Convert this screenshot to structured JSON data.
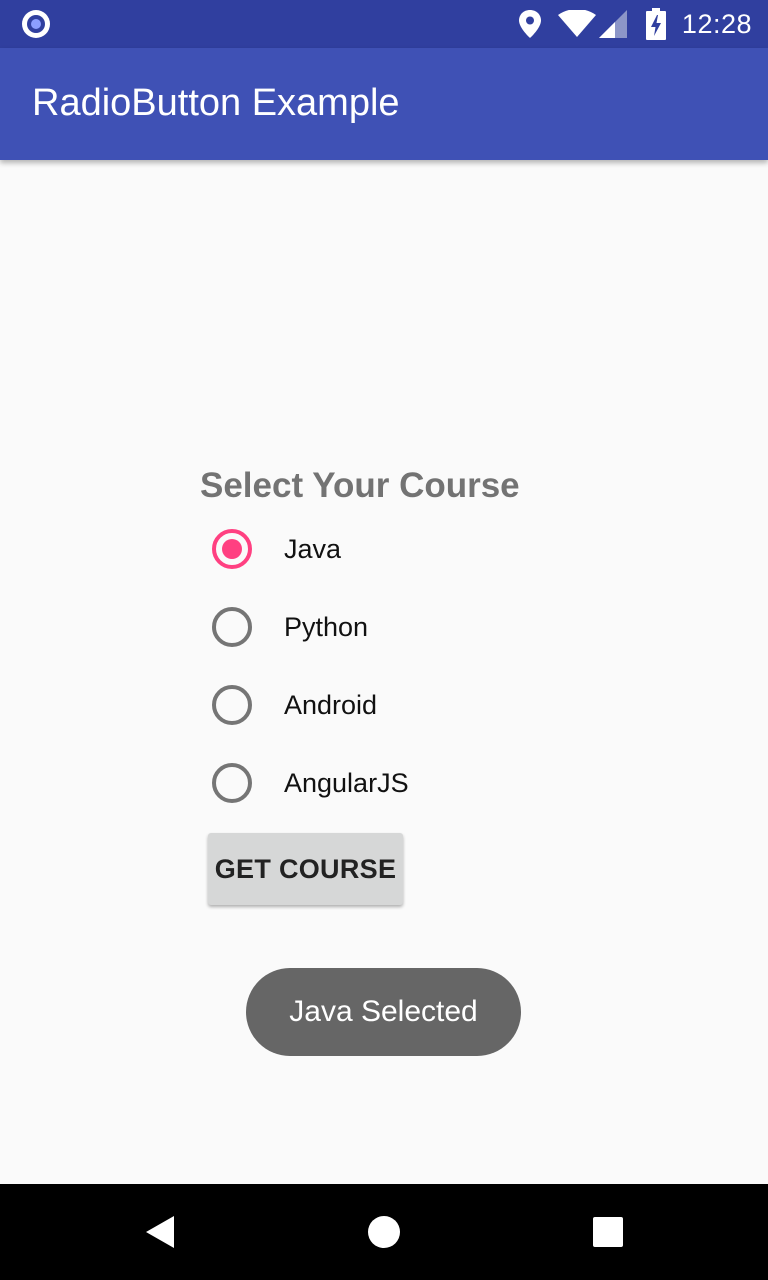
{
  "status_bar": {
    "time": "12:28",
    "icons": [
      "notification-ring-icon",
      "location-icon",
      "wifi-icon",
      "cell-signal-icon",
      "battery-charging-icon"
    ]
  },
  "app_bar": {
    "title": "RadioButton Example",
    "color": "#3f51b5"
  },
  "form": {
    "heading": "Select Your Course",
    "options": [
      {
        "label": "Java",
        "checked": true
      },
      {
        "label": "Python",
        "checked": false
      },
      {
        "label": "Android",
        "checked": false
      },
      {
        "label": "AngularJS",
        "checked": false
      }
    ],
    "button_label": "GET COURSE",
    "accent_color": "#ff4081"
  },
  "toast": {
    "message": "Java Selected"
  },
  "nav_bar": {
    "icons": [
      "back-icon",
      "home-icon",
      "recents-icon"
    ]
  }
}
